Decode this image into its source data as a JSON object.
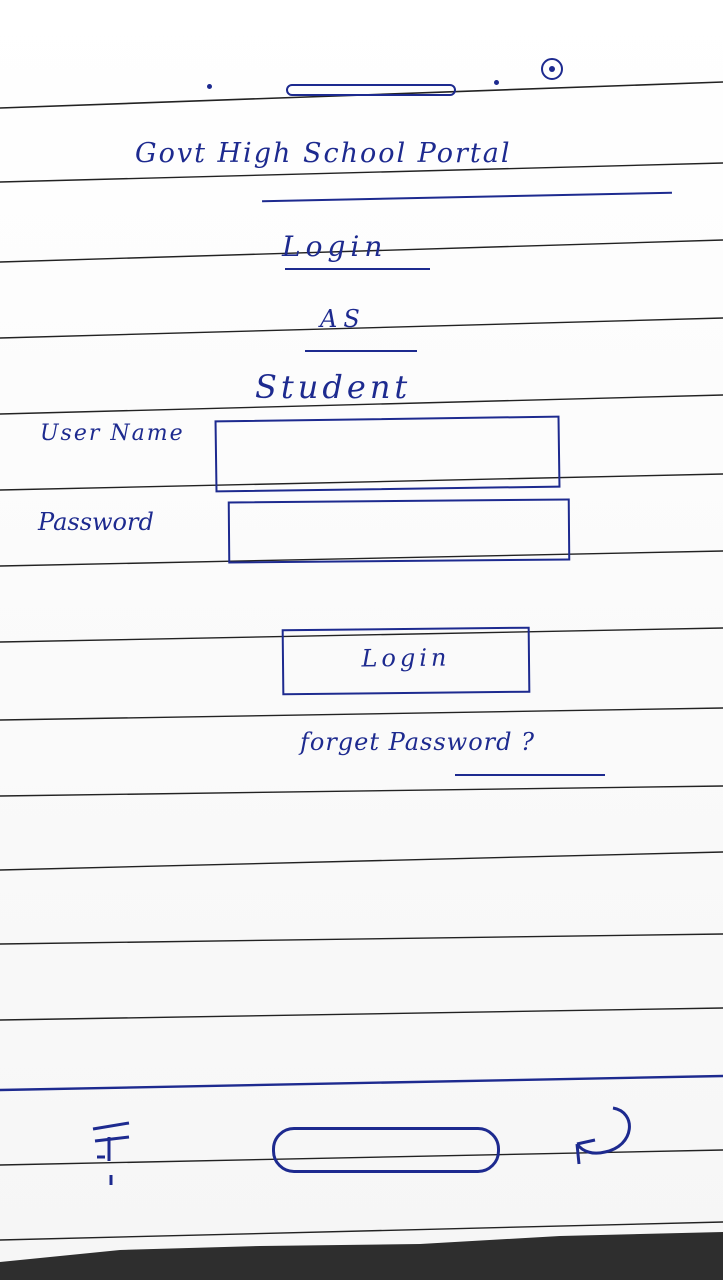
{
  "title": "Govt High School Portal",
  "heading": {
    "login": "Login",
    "as": "AS",
    "role": "Student"
  },
  "form": {
    "username_label": "User Name",
    "username_value": "",
    "password_label": "Password",
    "password_value": "",
    "login_button": "Login",
    "forgot_link": "forget Password ?"
  },
  "status_bar": {
    "icons": [
      "dot-icon",
      "speaker-bar-icon",
      "dot-icon",
      "camera-icon"
    ]
  },
  "nav_bar": {
    "icons": [
      "menu-icon",
      "home-icon",
      "back-icon"
    ]
  },
  "colors": {
    "ink": "#1d2a8f",
    "paper": "#fbfbfb",
    "rule_line": "#222222"
  }
}
